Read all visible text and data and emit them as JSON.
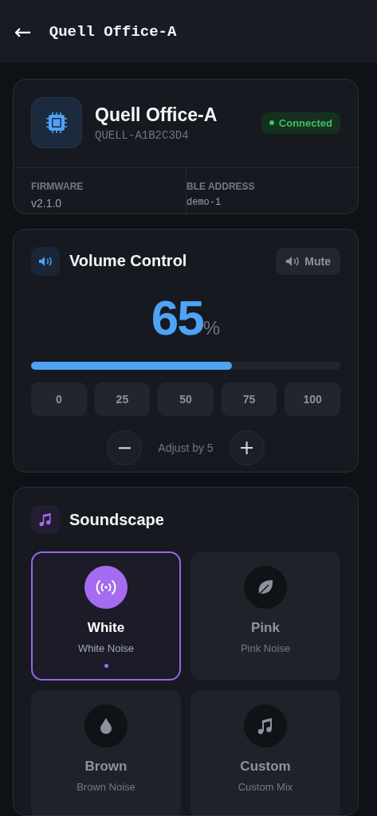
{
  "header": {
    "back": "←",
    "title": "Quell Office-A"
  },
  "device": {
    "name": "Quell Office-A",
    "serial": "QUELL-A1B2C3D4",
    "status": {
      "label": "Connected",
      "connected": true
    },
    "info": [
      {
        "label": "FIRMWARE",
        "value": "v2.1.0",
        "mono": false
      },
      {
        "label": "BLE ADDRESS",
        "value": "demo-1",
        "mono": true
      }
    ]
  },
  "volume": {
    "title": "Volume Control",
    "mute": {
      "label": "Mute",
      "muted": false
    },
    "value": "65",
    "unit": "%",
    "level": 0.65,
    "presets": [
      "0",
      "25",
      "50",
      "75",
      "100"
    ],
    "minus": "−",
    "step_label": "Adjust by 5",
    "plus": "+"
  },
  "soundscape": {
    "title": "Soundscape",
    "items": [
      {
        "kind": "white",
        "name": "White",
        "subtitle": "White Noise",
        "selected": true
      },
      {
        "kind": "pink",
        "name": "Pink",
        "subtitle": "Pink Noise",
        "selected": false
      },
      {
        "kind": "brown",
        "name": "Brown",
        "subtitle": "Brown Noise",
        "selected": false
      },
      {
        "kind": "custom",
        "name": "Custom",
        "subtitle": "Custom Mix",
        "selected": false
      }
    ]
  }
}
